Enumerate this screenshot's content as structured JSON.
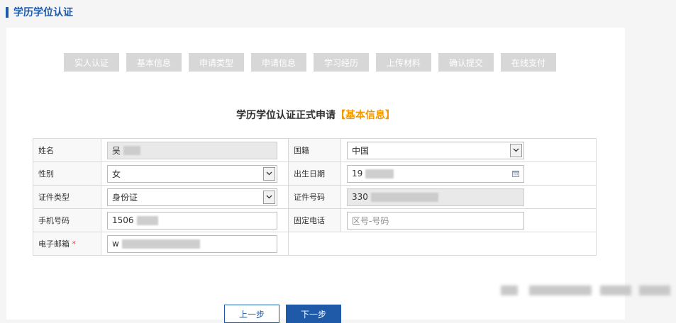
{
  "page": {
    "title": "学历学位认证"
  },
  "steps": [
    "实人认证",
    "基本信息",
    "申请类型",
    "申请信息",
    "学习经历",
    "上传材料",
    "确认提交",
    "在线支付"
  ],
  "form": {
    "title_main": "学历学位认证正式申请",
    "title_highlight": "【基本信息】",
    "name": {
      "label": "姓名",
      "value": "吴"
    },
    "nationality": {
      "label": "国籍",
      "value": "中国"
    },
    "gender": {
      "label": "性别",
      "value": "女"
    },
    "birthdate": {
      "label": "出生日期",
      "value": "19"
    },
    "id_type": {
      "label": "证件类型",
      "value": "身份证"
    },
    "id_number": {
      "label": "证件号码",
      "value": "330"
    },
    "mobile": {
      "label": "手机号码",
      "value": "1506"
    },
    "landline": {
      "label": "固定电话",
      "placeholder": "区号-号码"
    },
    "email": {
      "label": "电子邮箱",
      "required_mark": "*",
      "value": "w"
    }
  },
  "buttons": {
    "prev": "上一步",
    "next": "下一步"
  },
  "colors": {
    "primary": "#1e5aa8",
    "highlight": "#f39800",
    "step_bg": "#d7d7d7",
    "required": "#e4393c"
  }
}
